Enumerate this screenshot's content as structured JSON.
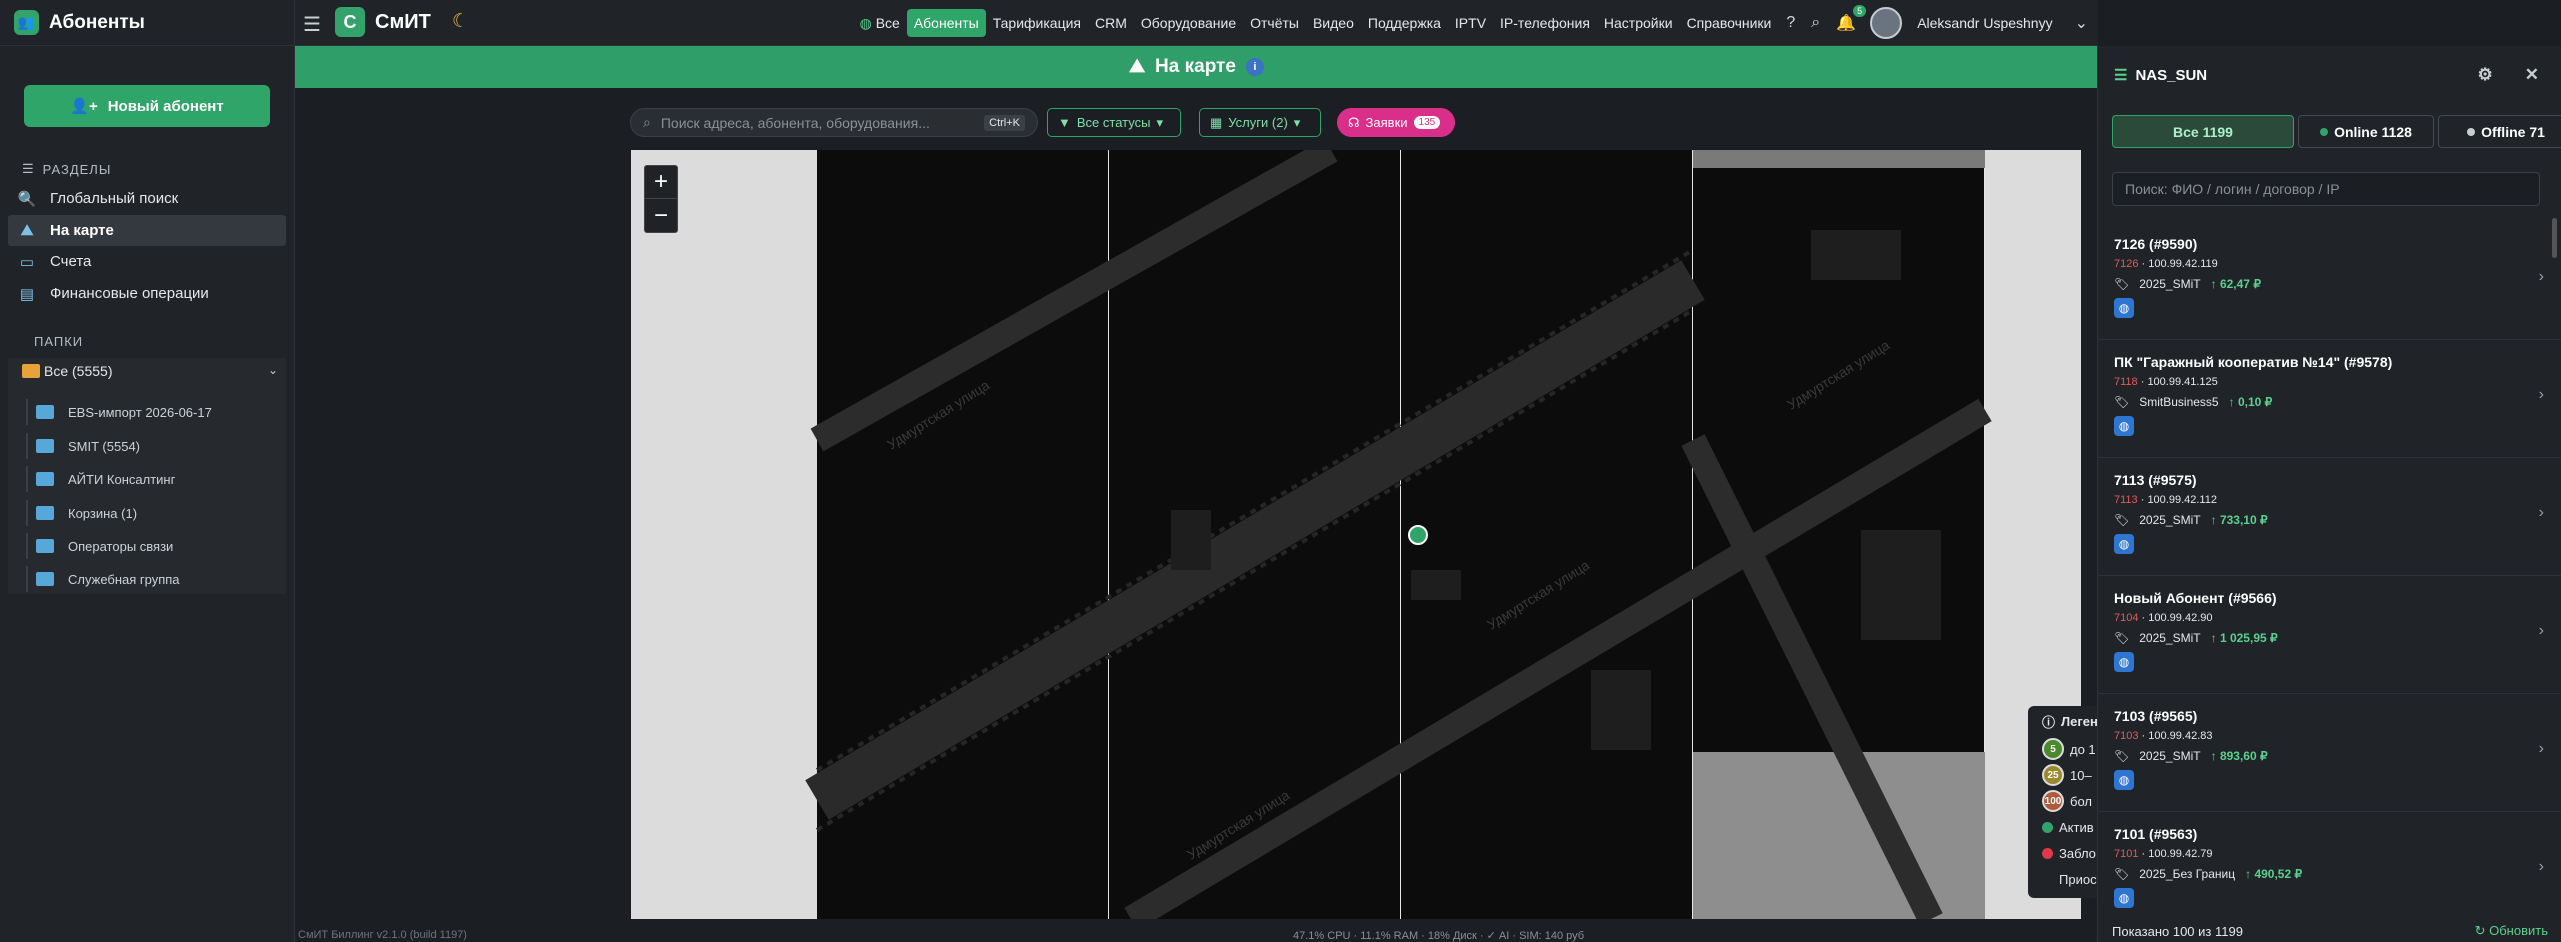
{
  "sidebar": {
    "title": "Абоненты",
    "new_button": "Новый абонент",
    "sections_label": "РАЗДЕЛЫ",
    "items": [
      {
        "label": "Глобальный поиск"
      },
      {
        "label": "На карте",
        "active": true
      },
      {
        "label": "Счета"
      },
      {
        "label": "Финансовые операции"
      }
    ],
    "folders_label": "ПАПКИ",
    "folder_all": "Все (5555)",
    "folders": [
      {
        "label": "EBS-импорт 2026-06-17"
      },
      {
        "label": "SMIT (5554)"
      },
      {
        "label": "АЙТИ Консалтинг"
      },
      {
        "label": "Корзина (1)"
      },
      {
        "label": "Операторы связи"
      },
      {
        "label": "Служебная группа"
      }
    ]
  },
  "topbar": {
    "brand": "СмИТ",
    "menu": [
      "Все",
      "Абоненты",
      "Тарификация",
      "CRM",
      "Оборудование",
      "Отчёты",
      "Видео",
      "Поддержка",
      "IPTV",
      "IP-телефония",
      "Настройки",
      "Справочники"
    ],
    "active_index": 1,
    "notif_count": "5",
    "user": "Aleksandr Uspeshnyy"
  },
  "page": {
    "title": "На карте"
  },
  "toolbar": {
    "search_placeholder": "Поиск адреса, абонента, оборудования...",
    "search_kbd": "Ctrl+K",
    "status_filter": "Все статусы",
    "services_filter": "Услуги (2)",
    "requests_label": "Заявки",
    "requests_count": "135"
  },
  "map": {
    "street_label": "Удмуртская улица",
    "legend": {
      "title": "Легенда",
      "rows": [
        {
          "num": "5",
          "text": "до 1",
          "color": "#4a8a2c"
        },
        {
          "num": "25",
          "text": "10–",
          "color": "#9a8a2c"
        },
        {
          "num": "100",
          "text": "бол",
          "color": "#b05a3c"
        }
      ],
      "status": [
        {
          "text": "Актив",
          "color": "#2fa569"
        },
        {
          "text": "Забло",
          "color": "#e0384b"
        },
        {
          "text": "Приос",
          "color": "transparent"
        }
      ]
    }
  },
  "footer": {
    "version": "СмИТ Биллинг v2.1.0 (build 1197)",
    "stats": "47.1% CPU · 11.1% RAM · 18% Диск · ✓ AI · SIM: 140 руб"
  },
  "panel": {
    "title": "NAS_SUN",
    "tabs": [
      {
        "label": "Все 1199"
      },
      {
        "label": "Online 1128"
      },
      {
        "label": "Offline 71"
      }
    ],
    "search_placeholder": "Поиск: ФИО / логин / договор / IP",
    "items": [
      {
        "title": "7126 (#9590)",
        "login": "7126",
        "ip": "100.99.42.119",
        "tariff": "2025_SMiT",
        "balance": "62,47 ₽"
      },
      {
        "title": "ПК \"Гаражный кооператив №14\" (#9578)",
        "login": "7118",
        "ip": "100.99.41.125",
        "tariff": "SmitBusiness5",
        "balance": "0,10 ₽"
      },
      {
        "title": "7113 (#9575)",
        "login": "7113",
        "ip": "100.99.42.112",
        "tariff": "2025_SMiT",
        "balance": "733,10 ₽"
      },
      {
        "title": "Новый Абонент (#9566)",
        "login": "7104",
        "ip": "100.99.42.90",
        "tariff": "2025_SMiT",
        "balance": "1 025,95 ₽"
      },
      {
        "title": "7103 (#9565)",
        "login": "7103",
        "ip": "100.99.42.83",
        "tariff": "2025_SMiT",
        "balance": "893,60 ₽"
      },
      {
        "title": "7101 (#9563)",
        "login": "7101",
        "ip": "100.99.42.79",
        "tariff": "2025_Без Границ",
        "balance": "490,52 ₽"
      }
    ],
    "footer": "Показано 100 из 1199",
    "refresh": "Обновить"
  }
}
